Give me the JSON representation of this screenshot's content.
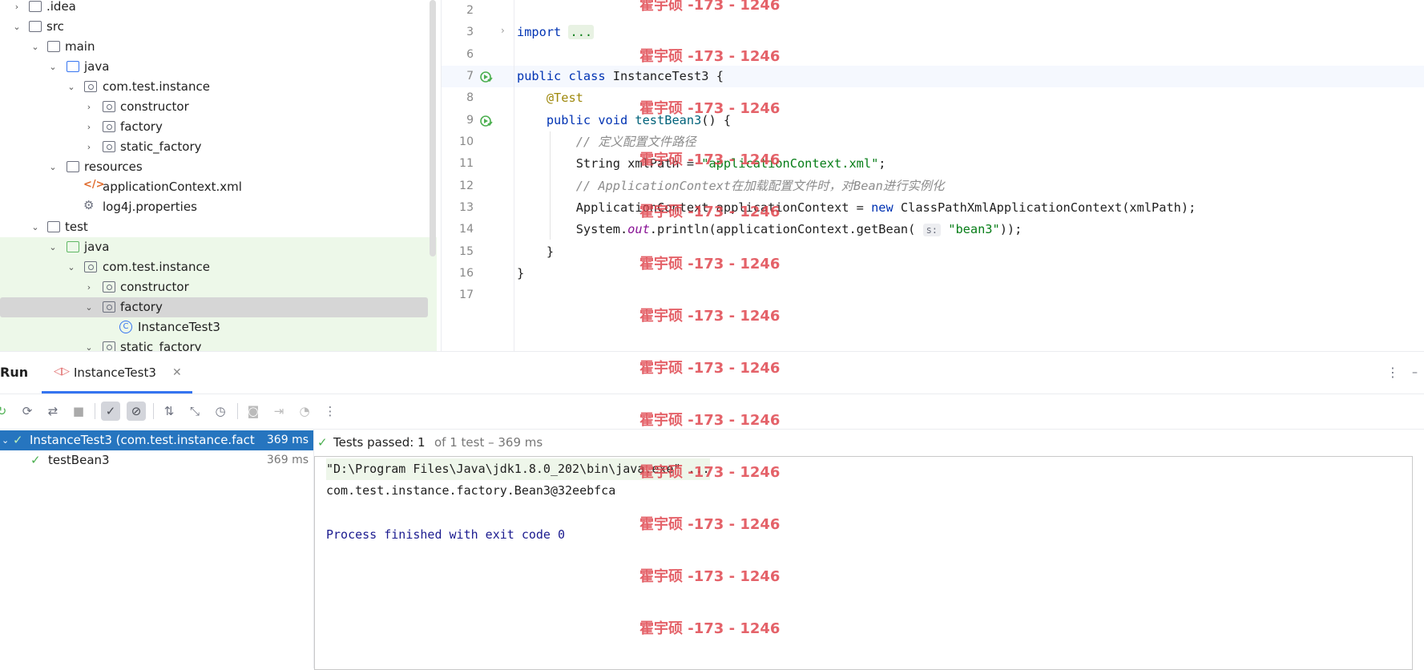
{
  "project_tree": {
    "items": [
      {
        "label": ".idea",
        "expanded": false,
        "icon": "folder-icon"
      },
      {
        "label": "src",
        "expanded": true,
        "icon": "folder-icon"
      },
      {
        "label": "main",
        "expanded": true,
        "icon": "folder-icon"
      },
      {
        "label": "java",
        "expanded": true,
        "icon": "source-folder-icon"
      },
      {
        "label": "com.test.instance",
        "expanded": true,
        "icon": "package-icon"
      },
      {
        "label": "constructor",
        "expanded": false,
        "icon": "package-icon"
      },
      {
        "label": "factory",
        "expanded": false,
        "icon": "package-icon"
      },
      {
        "label": "static_factory",
        "expanded": false,
        "icon": "package-icon"
      },
      {
        "label": "resources",
        "expanded": true,
        "icon": "resources-folder-icon"
      },
      {
        "label": "applicationContext.xml",
        "icon": "xml-file-icon"
      },
      {
        "label": "log4j.properties",
        "icon": "properties-file-icon"
      },
      {
        "label": "test",
        "expanded": true,
        "icon": "folder-icon"
      },
      {
        "label": "java",
        "expanded": true,
        "icon": "test-source-folder-icon"
      },
      {
        "label": "com.test.instance",
        "expanded": true,
        "icon": "package-icon"
      },
      {
        "label": "constructor",
        "expanded": false,
        "icon": "package-icon"
      },
      {
        "label": "factory",
        "expanded": true,
        "icon": "package-icon",
        "selected": true
      },
      {
        "label": "InstanceTest3",
        "icon": "class-icon"
      },
      {
        "label": "static_factory",
        "expanded": true,
        "icon": "package-icon"
      }
    ]
  },
  "editor": {
    "line_numbers": [
      "2",
      "3",
      "6",
      "7",
      "8",
      "9",
      "10",
      "11",
      "12",
      "13",
      "14",
      "15",
      "16",
      "17"
    ],
    "import_keyword": "import",
    "import_fold": "...",
    "l7_public": "public",
    "l7_class": "class",
    "l7_name": "InstanceTest3",
    "l7_brace": "{",
    "l8_annotation": "@Test",
    "l9_public": "public",
    "l9_void": "void",
    "l9_method": "testBean3",
    "l9_rest": "() {",
    "l10_comment": "// 定义配置文件路径",
    "l11_type": "String xmlPath = ",
    "l11_str": "\"applicationContext.xml\"",
    "l11_end": ";",
    "l12_comment": "// ApplicationContext在加载配置文件时，对Bean进行实例化",
    "l13_a": "ApplicationContext applicationContext = ",
    "l13_new": "new",
    "l13_b": " ClassPathXmlApplicationContext(xmlPath);",
    "l14_a": "System.",
    "l14_out": "out",
    "l14_b": ".println(applicationContext.getBean(",
    "l14_hint": "s:",
    "l14_str": "\"bean3\"",
    "l14_c": "));",
    "l15": "}",
    "l16": "}"
  },
  "run_panel": {
    "title": "Run",
    "tab_label": "InstanceTest3",
    "tests": [
      {
        "label": "InstanceTest3 (com.test.instance.fact",
        "time": "369 ms",
        "status": "passed",
        "selected": true
      },
      {
        "label": "testBean3",
        "time": "369 ms",
        "status": "passed"
      }
    ],
    "summary_bold": "Tests passed: 1",
    "summary_rest": "of 1 test – 369 ms",
    "console_lines": [
      "\"D:\\Program Files\\Java\\jdk1.8.0_202\\bin\\java.exe\" ...",
      "com.test.instance.factory.Bean3@32eebfca",
      "",
      "Process finished with exit code 0"
    ]
  },
  "watermark": "霍宇硕 -173 - 1246",
  "colors": {
    "accent": "#3574f0",
    "selection": "#2675bf",
    "green_highlight": "#edf8e9",
    "watermark": "#e0474f"
  }
}
